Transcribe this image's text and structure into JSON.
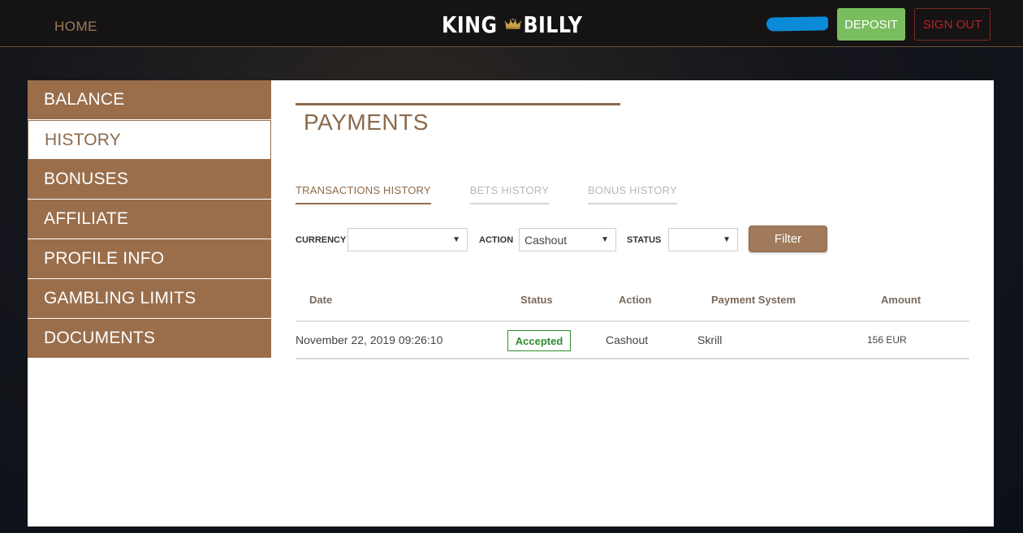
{
  "header": {
    "home_label": "HOME",
    "logo_left": "KING",
    "logo_right": "BILLY",
    "deposit_label": "DEPOSIT",
    "signout_label": "SIGN OUT"
  },
  "sidebar": {
    "items": [
      {
        "label": "BALANCE"
      },
      {
        "label": "HISTORY"
      },
      {
        "label": "BONUSES"
      },
      {
        "label": "AFFILIATE"
      },
      {
        "label": "PROFILE INFO"
      },
      {
        "label": "GAMBLING LIMITS"
      },
      {
        "label": "DOCUMENTS"
      }
    ],
    "active_index": 1
  },
  "main": {
    "title": "PAYMENTS",
    "tabs": [
      {
        "label": "TRANSACTIONS HISTORY"
      },
      {
        "label": "BETS HISTORY"
      },
      {
        "label": "BONUS HISTORY"
      }
    ],
    "filters": {
      "currency_label": "CURRENCY",
      "currency_value": "",
      "action_label": "ACTION",
      "action_value": "Cashout",
      "status_label": "STATUS",
      "status_value": "",
      "filter_button": "Filter"
    },
    "table": {
      "headers": [
        "Date",
        "Status",
        "Action",
        "Payment System",
        "Amount"
      ],
      "rows": [
        {
          "date": "November 22, 2019 09:26:10",
          "status": "Accepted",
          "action": "Cashout",
          "payment_system": "Skrill",
          "amount": "156 EUR"
        }
      ]
    }
  },
  "colors": {
    "brand_brown": "#9a6e4b",
    "deposit_green": "#79bd5f",
    "signout_red": "#b3242a",
    "accepted_green": "#2e8b2e"
  }
}
